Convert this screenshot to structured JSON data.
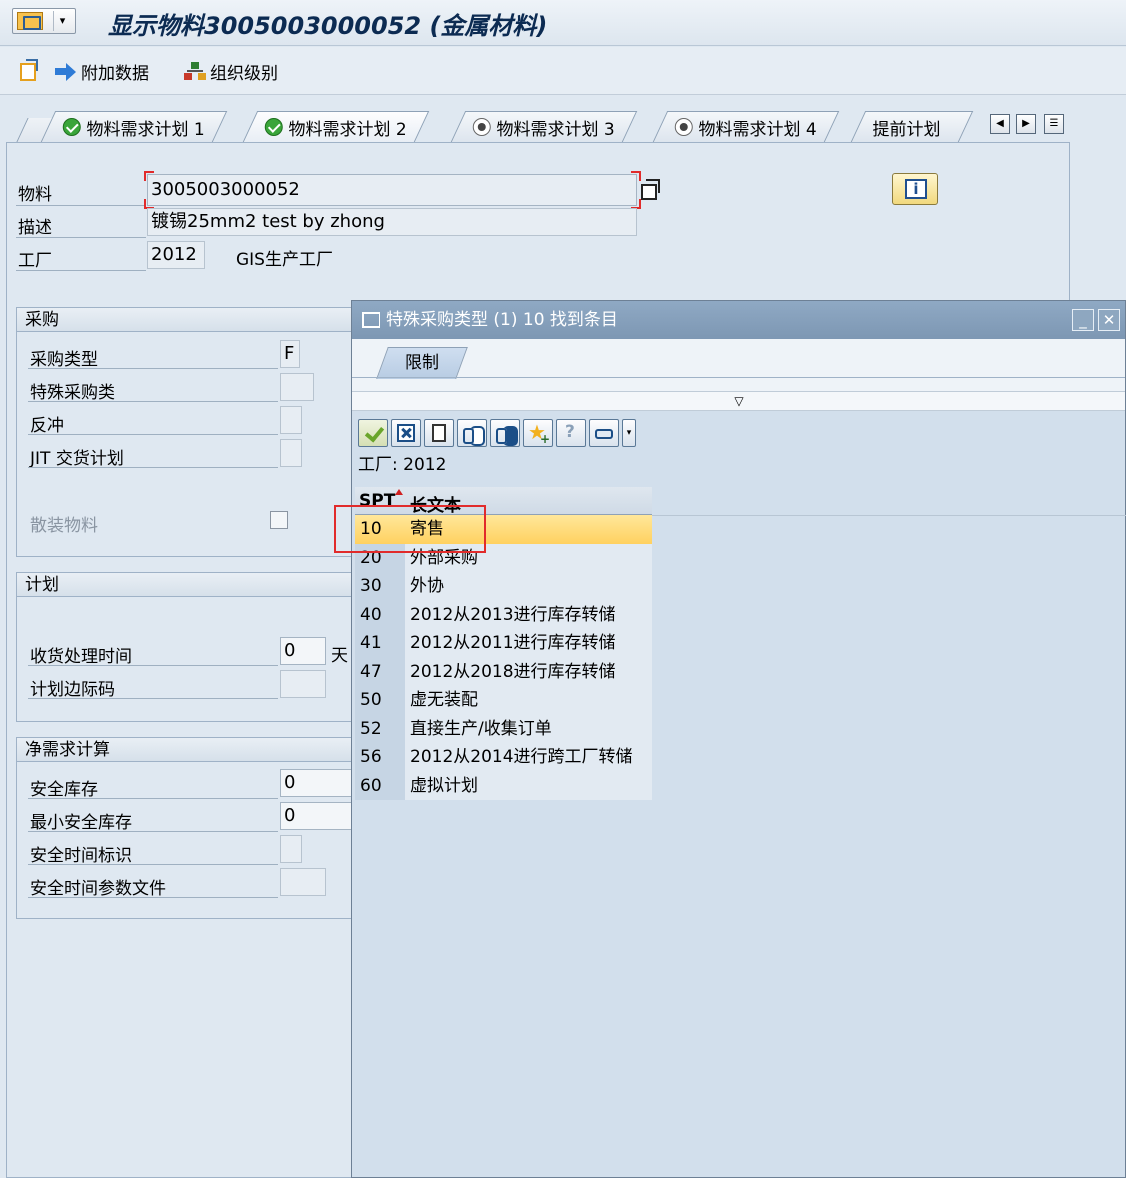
{
  "window": {
    "title": "显示物料3005003000052 (金属材料)"
  },
  "toolbar": {
    "additional_data": "附加数据",
    "org_levels": "组织级别"
  },
  "tabs": [
    {
      "label": "物料需求计划 1",
      "status": "ok"
    },
    {
      "label": "物料需求计划 2",
      "status": "ok",
      "active": true
    },
    {
      "label": "物料需求计划 3",
      "status": "radio"
    },
    {
      "label": "物料需求计划 4",
      "status": "radio"
    },
    {
      "label": "提前计划"
    }
  ],
  "header": {
    "material_label": "物料",
    "material_value": "3005003000052",
    "description_label": "描述",
    "description_value": "镀锡25mm2 test by zhong",
    "plant_label": "工厂",
    "plant_value": "2012",
    "plant_name": "GIS生产工厂"
  },
  "procurement": {
    "title": "采购",
    "procurement_type_label": "采购类型",
    "procurement_type_value": "F",
    "special_procurement_label": "特殊采购类",
    "backflush_label": "反冲",
    "jit_label": "JIT 交货计划",
    "bulk_material_label": "散装物料"
  },
  "scheduling": {
    "title": "计划",
    "gr_processing_label": "收货处理时间",
    "gr_processing_value": "0",
    "gr_unit": "天",
    "margin_key_label": "计划边际码"
  },
  "net_requirements": {
    "title": "净需求计算",
    "safety_stock_label": "安全库存",
    "safety_stock_value": "0",
    "min_safety_stock_label": "最小安全库存",
    "min_safety_stock_value": "0",
    "safety_time_ind_label": "安全时间标识",
    "safety_time_profile_label": "安全时间参数文件"
  },
  "popup": {
    "title": "特殊采购类型 (1)   10 找到条目",
    "restrict_tab": "限制",
    "plant_filter": "工厂: 2012",
    "columns": [
      "SPT",
      "长文本"
    ],
    "rows": [
      {
        "code": "10",
        "text": "寄售",
        "selected": true
      },
      {
        "code": "20",
        "text": "外部采购"
      },
      {
        "code": "30",
        "text": "外协"
      },
      {
        "code": "40",
        "text": "2012从2013进行库存转储"
      },
      {
        "code": "41",
        "text": "2012从2011进行库存转储"
      },
      {
        "code": "47",
        "text": "2012从2018进行库存转储"
      },
      {
        "code": "50",
        "text": "虚无装配"
      },
      {
        "code": "52",
        "text": "直接生产/收集订单"
      },
      {
        "code": "56",
        "text": "2012从2014进行跨工厂转储"
      },
      {
        "code": "60",
        "text": "虚拟计划"
      }
    ]
  },
  "colors": {
    "selection": "#ffd160",
    "highlight_box": "#e12b2b",
    "popup_title_bg": "#7d97b3"
  }
}
